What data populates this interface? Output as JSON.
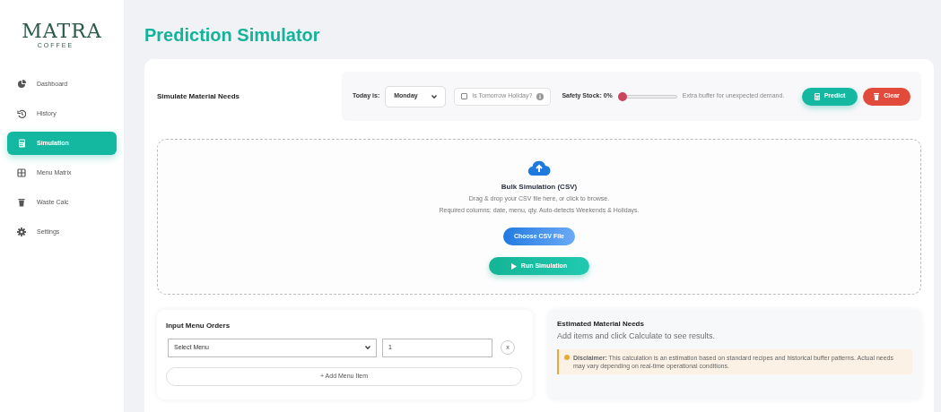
{
  "logo": {
    "name": "MATRA",
    "tagline": "COFFEE"
  },
  "sidebar": {
    "items": [
      {
        "label": "Dashboard",
        "kind": "pie",
        "selected": false
      },
      {
        "label": "History",
        "kind": "history",
        "selected": false
      },
      {
        "label": "Simulation",
        "kind": "calculator",
        "selected": true
      },
      {
        "label": "Menu Matrix",
        "kind": "grid",
        "selected": false
      },
      {
        "label": "Waste Calc",
        "kind": "trash",
        "selected": false
      },
      {
        "label": "Settings",
        "kind": "gear",
        "selected": false
      }
    ]
  },
  "page_title": "Prediction Simulator",
  "simulate": {
    "title": "Simulate Material Needs",
    "today_label": "Today is:",
    "today_value": "Monday",
    "holiday": {
      "label": "Is Tomorrow Holiday?",
      "checked": false
    },
    "safety_stock": {
      "label": "Safety Stock: 0%",
      "level": 0,
      "hint": "Extra buffer for unexpected demand."
    },
    "buttons": [
      {
        "label": "Predict",
        "kind": "predict"
      },
      {
        "label": "Clear",
        "kind": "clear"
      }
    ]
  },
  "bulk": {
    "title": "Bulk Simulation (CSV)",
    "subtitle": "Drag & drop your CSV file here, or click to browse.",
    "note": "Required columns: date, menu, qty. Auto-detects Weekends & Holidays.",
    "choose_button": "Choose CSV File",
    "run_button": "Run Simulation"
  },
  "orders": {
    "title": "Input Menu Orders",
    "rows": [
      {
        "menu": "Select Menu",
        "qty": "1",
        "remove": "x"
      }
    ],
    "add_button": "+ Add Menu Item"
  },
  "results": {
    "title": "Estimated Material Needs",
    "subtitle": "Add items and click Calculate to see results.",
    "disclaimer": "**Disclaimer:** This calculation is an estimation based on standard recipes and historical buffer patterns. Actual needs may vary depending on real-time operational conditions."
  }
}
